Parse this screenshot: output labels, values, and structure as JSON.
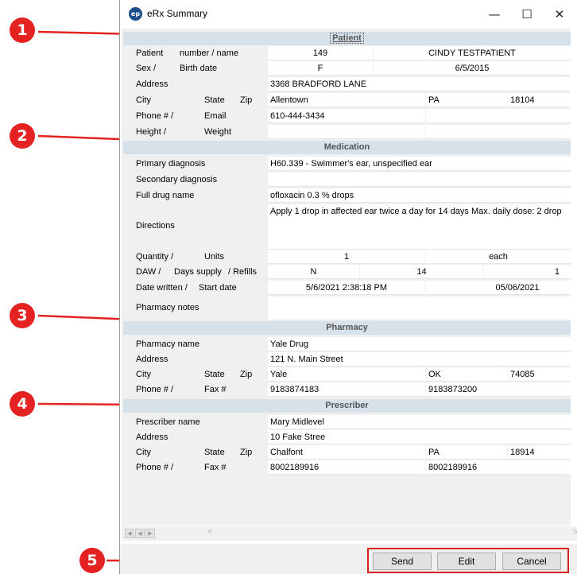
{
  "window": {
    "title": "eRx Summary",
    "icon_text": "ep"
  },
  "patient": {
    "header": "Patient",
    "labels": {
      "patient": "Patient",
      "number_name": "number / name",
      "sex": "Sex /",
      "birth_date": "Birth date",
      "address": "Address",
      "city": "City",
      "state": "State",
      "zip": "Zip",
      "phone": "Phone # /",
      "email": "Email",
      "height": "Height /",
      "weight": "Weight"
    },
    "number": "149",
    "name": "CINDY TESTPATIENT",
    "sex": "F",
    "birth_date": "6/5/2015",
    "address": "3368 BRADFORD LANE",
    "city": "Allentown",
    "state": "PA",
    "zip": "18104",
    "phone": "610-444-3434",
    "email": "",
    "height": "",
    "weight": ""
  },
  "medication": {
    "header": "Medication",
    "labels": {
      "primary_diagnosis": "Primary diagnosis",
      "secondary_diagnosis": "Secondary diagnosis",
      "full_drug_name": "Full drug name",
      "directions": "Directions",
      "quantity": "Quantity /",
      "units": "Units",
      "daw": "DAW /",
      "days_supply": "Days supply",
      "refills": "/ Refills",
      "date_written": "Date written /",
      "start_date": "Start date",
      "pharmacy_notes": "Pharmacy notes"
    },
    "primary_diagnosis": "H60.339 - Swimmer's ear, unspecified ear",
    "secondary_diagnosis": "",
    "full_drug_name": "ofloxacin 0.3 % drops",
    "directions": "Apply 1 drop in affected ear twice a day for 14 days Max. daily dose: 2 drop",
    "quantity": "1",
    "units": "each",
    "daw": "N",
    "days_supply": "14",
    "refills": "1",
    "date_written": "5/6/2021 2:38:18 PM",
    "start_date": "05/06/2021",
    "pharmacy_notes": ""
  },
  "pharmacy": {
    "header": "Pharmacy",
    "labels": {
      "name": "Pharmacy name",
      "address": "Address",
      "city": "City",
      "state": "State",
      "zip": "Zip",
      "phone": "Phone # /",
      "fax": "Fax #"
    },
    "name": "Yale Drug",
    "address": "121 N. Main Street",
    "city": "Yale",
    "state": "OK",
    "zip": "74085",
    "phone": "9183874183",
    "fax": "9183873200"
  },
  "prescriber": {
    "header": "Prescriber",
    "labels": {
      "name": "Prescriber name",
      "address": "Address",
      "city": "City",
      "state": "State",
      "zip": "Zip",
      "phone": "Phone # /",
      "fax": "Fax #"
    },
    "name": "Mary Midlevel",
    "address": "10 Fake Stree",
    "city": "Chalfont",
    "state": "PA",
    "zip": "18914",
    "phone": "8002189916",
    "fax": "8002189916"
  },
  "buttons": {
    "send": "Send",
    "edit": "Edit",
    "cancel": "Cancel"
  },
  "markers": [
    "1",
    "2",
    "3",
    "4",
    "5"
  ],
  "colors": {
    "marker": "#e52222",
    "section_header": "#d7e1ea",
    "background": "#f0f0f0"
  }
}
